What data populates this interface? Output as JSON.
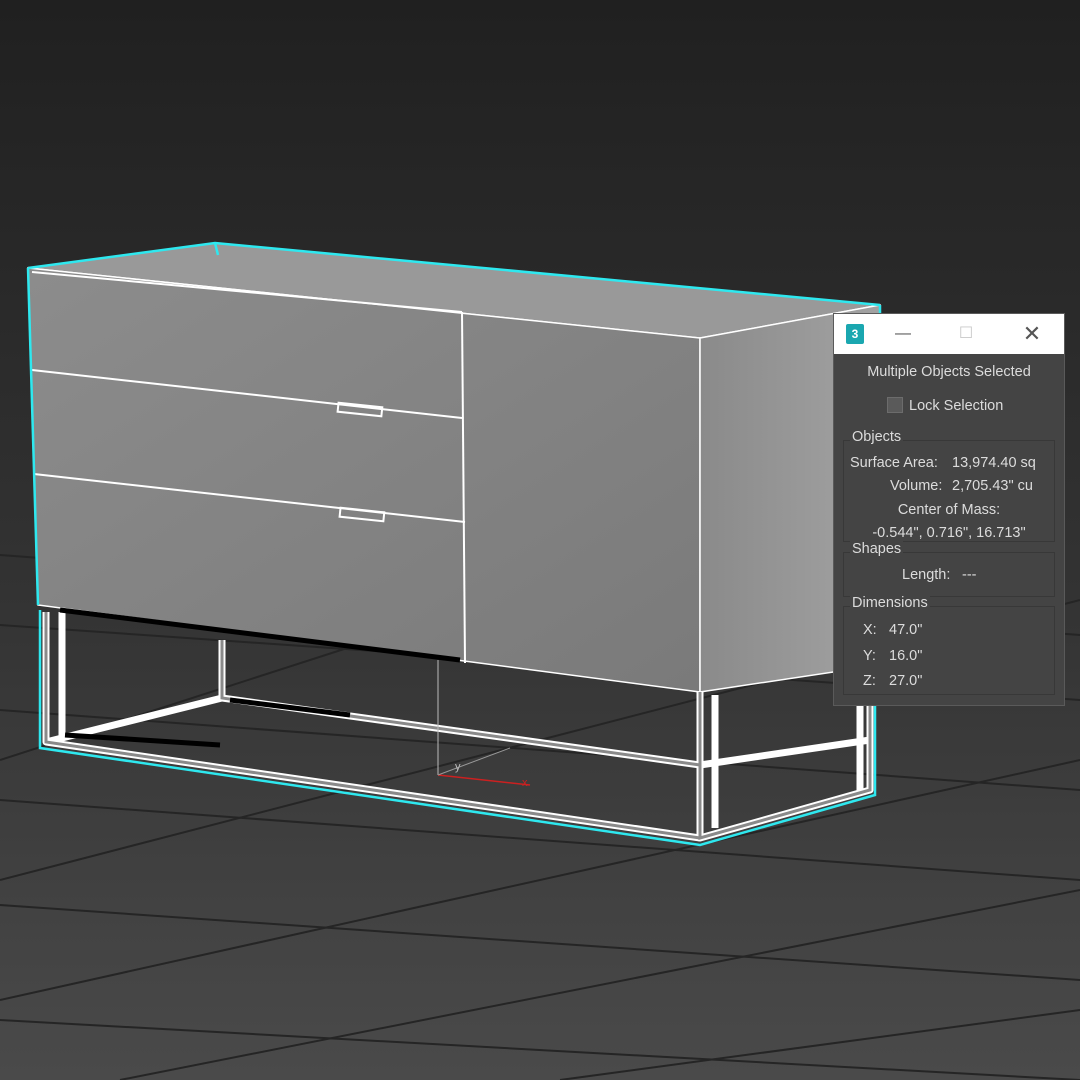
{
  "dialog": {
    "app_icon": "3ds-max-icon",
    "app_icon_text": "3",
    "minimize_glyph": "—",
    "maximize_glyph": "☐",
    "close_glyph": "✕",
    "selection_status": "Multiple Objects Selected",
    "lock_selection_label": "Lock Selection",
    "lock_selection_checked": false,
    "objects": {
      "title": "Objects",
      "surface_area_label": "Surface Area:",
      "surface_area_value": "13,974.40 sq",
      "volume_label": "Volume:",
      "volume_value": "2,705.43\" cu",
      "center_of_mass_label": "Center of Mass:",
      "center_of_mass_value": "-0.544\", 0.716\", 16.713\""
    },
    "shapes": {
      "title": "Shapes",
      "length_label": "Length:",
      "length_value": "---"
    },
    "dimensions": {
      "title": "Dimensions",
      "x_label": "X:",
      "x_value": "47.0\"",
      "y_label": "Y:",
      "y_value": "16.0\"",
      "z_label": "Z:",
      "z_value": "27.0\""
    }
  },
  "viewport": {
    "gizmo_axes": [
      "x",
      "y",
      "z"
    ],
    "colors": {
      "background_top": "#212121",
      "background_bottom": "#4a4a4a",
      "grid": "#262626",
      "selection_outline": "#2ee8ef",
      "wire": "#ffffff",
      "gizmo_x": "#cc2020"
    }
  }
}
